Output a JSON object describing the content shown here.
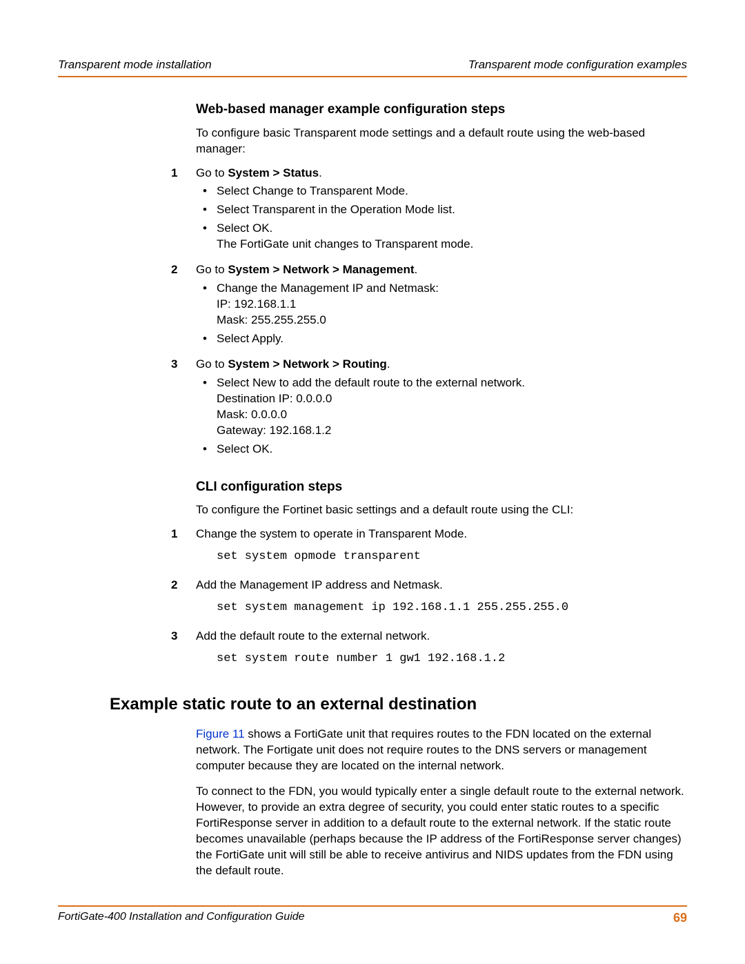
{
  "header": {
    "left": "Transparent mode installation",
    "right": "Transparent mode configuration examples"
  },
  "web": {
    "title": "Web-based manager example configuration steps",
    "intro": "To configure basic Transparent mode settings and a default route using the web-based manager:",
    "steps": [
      {
        "num": "1",
        "lead": "Go to ",
        "bold": "System > Status",
        "tail": ".",
        "bullets": [
          {
            "text": "Select Change to Transparent Mode."
          },
          {
            "text": "Select Transparent in the Operation Mode list."
          },
          {
            "text": "Select OK.",
            "sub": "The FortiGate unit changes to Transparent mode."
          }
        ]
      },
      {
        "num": "2",
        "lead": "Go to ",
        "bold": "System > Network > Management",
        "tail": ".",
        "bullets": [
          {
            "text": "Change the Management IP and Netmask:",
            "sub": "IP: 192.168.1.1\nMask: 255.255.255.0"
          },
          {
            "text": "Select Apply."
          }
        ]
      },
      {
        "num": "3",
        "lead": "Go to ",
        "bold": "System > Network > Routing",
        "tail": ".",
        "bullets": [
          {
            "text": "Select New to add the default route to the external network.",
            "sub": "Destination IP: 0.0.0.0\nMask: 0.0.0.0\nGateway: 192.168.1.2"
          },
          {
            "text": "Select OK."
          }
        ]
      }
    ]
  },
  "cli": {
    "title": "CLI configuration steps",
    "intro": "To configure the Fortinet basic settings and a default route using the CLI:",
    "steps": [
      {
        "num": "1",
        "text": "Change the system to operate in Transparent Mode.",
        "cmd": "set system opmode transparent"
      },
      {
        "num": "2",
        "text": "Add the Management IP address and Netmask.",
        "cmd": "set system management ip 192.168.1.1 255.255.255.0"
      },
      {
        "num": "3",
        "text": "Add the default route to the external network.",
        "cmd": "set system route number 1 gw1 192.168.1.2"
      }
    ]
  },
  "static": {
    "title": "Example static route to an external destination",
    "figref": "Figure 11",
    "p1_tail": " shows a FortiGate unit that requires routes to the FDN located on the external network. The Fortigate unit does not require routes to the DNS servers or management computer because they are located on the internal network.",
    "p2": "To connect to the FDN, you would typically enter a single default route to the external network. However, to provide an extra degree of security, you could enter static routes to a specific FortiResponse server in addition to a default route to the external network. If the static route becomes unavailable (perhaps because the IP address of the FortiResponse server changes) the FortiGate unit will still be able to receive antivirus and NIDS updates from the FDN using the default route."
  },
  "footer": {
    "left": "FortiGate-400 Installation and Configuration Guide",
    "page": "69"
  }
}
